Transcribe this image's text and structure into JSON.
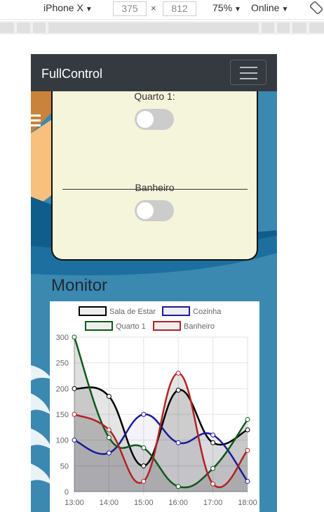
{
  "devtools": {
    "device": "iPhone X",
    "width": "375",
    "height": "812",
    "times": "×",
    "zoom": "75%",
    "network": "Online",
    "caret": "▼"
  },
  "app": {
    "brand": "FullControl"
  },
  "switches": [
    {
      "label": "Quarto 1:",
      "on": false
    },
    {
      "label": "Banheiro",
      "on": false
    }
  ],
  "monitor": {
    "title": "Monitor"
  },
  "chart_data": {
    "type": "line",
    "categories": [
      "13:00",
      "14:00",
      "15:00",
      "16:00",
      "17:00",
      "18:00"
    ],
    "ylim": [
      0,
      300
    ],
    "yticks": [
      0,
      50,
      100,
      150,
      200,
      250,
      300
    ],
    "grid": true,
    "legend_position": "top",
    "series": [
      {
        "name": "Sala de Estar",
        "values": [
          200,
          185,
          50,
          197,
          95,
          120
        ],
        "color": "#000000",
        "fill": "rgba(0,0,0,0.10)"
      },
      {
        "name": "Cozinha",
        "values": [
          100,
          75,
          150,
          95,
          110,
          20
        ],
        "color": "#1a1a9a",
        "fill": "rgba(20,20,120,0.05)"
      },
      {
        "name": "Quarto 1",
        "values": [
          300,
          105,
          85,
          10,
          45,
          140
        ],
        "color": "#0c5a1a",
        "fill": "rgba(0,0,0,0.12)"
      },
      {
        "name": "Banheiro",
        "values": [
          150,
          120,
          20,
          230,
          15,
          80
        ],
        "color": "#b22222",
        "fill": "rgba(0,0,0,0.10)"
      }
    ]
  }
}
